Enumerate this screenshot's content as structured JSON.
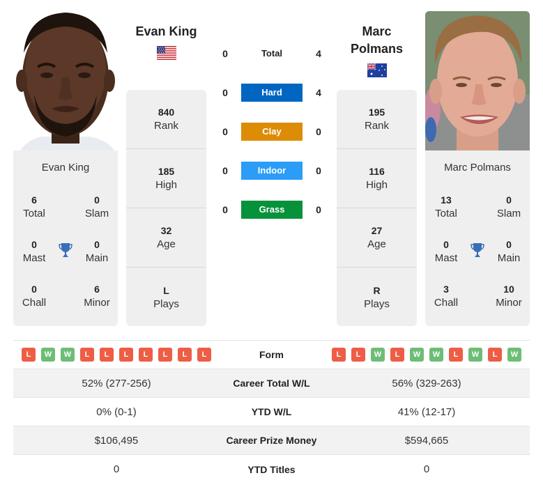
{
  "players": {
    "left": {
      "name": "Evan King",
      "country": "USA",
      "flag_icon": "us-flag-icon",
      "rank": "840",
      "rank_label": "Rank",
      "high": "185",
      "high_label": "High",
      "age": "32",
      "age_label": "Age",
      "plays": "L",
      "plays_label": "Plays",
      "titles": {
        "total": "6",
        "total_label": "Total",
        "slam": "0",
        "slam_label": "Slam",
        "mast": "0",
        "mast_label": "Mast",
        "main": "0",
        "main_label": "Main",
        "chall": "0",
        "chall_label": "Chall",
        "minor": "6",
        "minor_label": "Minor"
      }
    },
    "right": {
      "name": "Marc Polmans",
      "country": "Australia",
      "flag_icon": "australia-flag-icon",
      "rank": "195",
      "rank_label": "Rank",
      "high": "116",
      "high_label": "High",
      "age": "27",
      "age_label": "Age",
      "plays": "R",
      "plays_label": "Plays",
      "titles": {
        "total": "13",
        "total_label": "Total",
        "slam": "0",
        "slam_label": "Slam",
        "mast": "0",
        "mast_label": "Mast",
        "main": "0",
        "main_label": "Main",
        "chall": "3",
        "chall_label": "Chall",
        "minor": "10",
        "minor_label": "Minor"
      }
    }
  },
  "h2h": [
    {
      "label": "Total",
      "left": "0",
      "right": "4",
      "color": null
    },
    {
      "label": "Hard",
      "left": "0",
      "right": "4",
      "color": "#0066c2"
    },
    {
      "label": "Clay",
      "left": "0",
      "right": "0",
      "color": "#dd8c06"
    },
    {
      "label": "Indoor",
      "left": "0",
      "right": "0",
      "color": "#2b9cf7"
    },
    {
      "label": "Grass",
      "left": "0",
      "right": "0",
      "color": "#06923a"
    }
  ],
  "comparison": {
    "form_label": "Form",
    "form_left": [
      "L",
      "W",
      "W",
      "L",
      "L",
      "L",
      "L",
      "L",
      "L",
      "L"
    ],
    "form_right": [
      "L",
      "L",
      "W",
      "L",
      "W",
      "W",
      "L",
      "W",
      "L",
      "W"
    ],
    "rows": [
      {
        "label": "Career Total W/L",
        "left": "52% (277-256)",
        "right": "56% (329-263)"
      },
      {
        "label": "YTD W/L",
        "left": "0% (0-1)",
        "right": "41% (12-17)"
      },
      {
        "label": "Career Prize Money",
        "left": "$106,495",
        "right": "$594,665"
      },
      {
        "label": "YTD Titles",
        "left": "0",
        "right": "0"
      }
    ]
  },
  "colors": {
    "loss": "#ee5d45",
    "win": "#6ebd76",
    "trophy": "#3a6fb8"
  }
}
